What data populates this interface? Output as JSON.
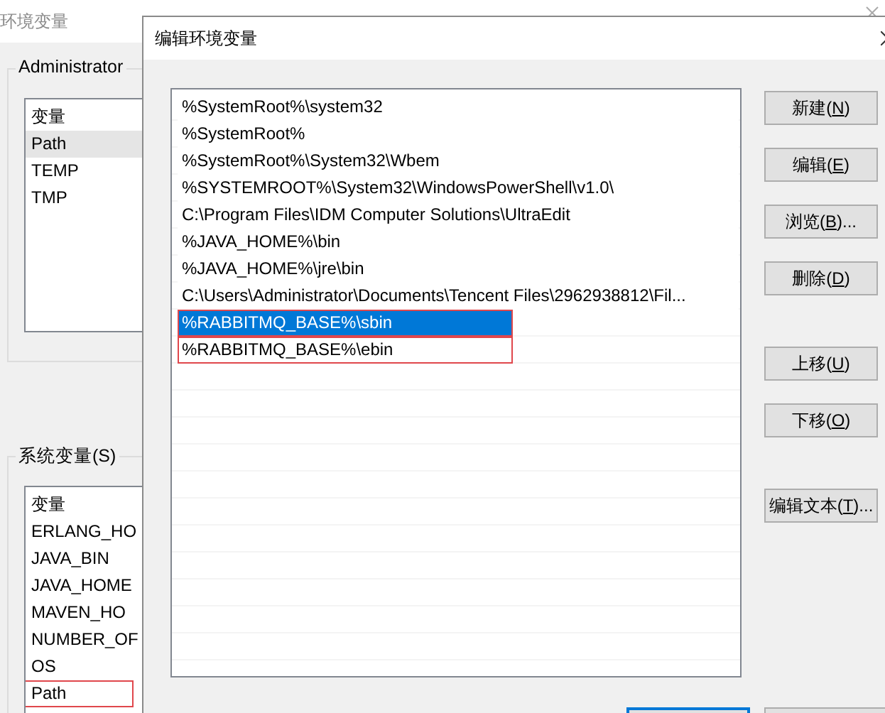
{
  "background_window": {
    "title": "环境变量",
    "user_group": {
      "title": "Administrator",
      "column": "变量",
      "rows": [
        {
          "name": "Path",
          "selected": true,
          "marked": false
        },
        {
          "name": "TEMP",
          "selected": false,
          "marked": false
        },
        {
          "name": "TMP",
          "selected": false,
          "marked": false
        }
      ]
    },
    "system_group": {
      "title": "系统变量(S)",
      "column": "变量",
      "rows": [
        {
          "name": "ERLANG_HO",
          "selected": false,
          "marked": false
        },
        {
          "name": "JAVA_BIN",
          "selected": false,
          "marked": false
        },
        {
          "name": "JAVA_HOME",
          "selected": false,
          "marked": false
        },
        {
          "name": "MAVEN_HO",
          "selected": false,
          "marked": false
        },
        {
          "name": "NUMBER_OF",
          "selected": false,
          "marked": false
        },
        {
          "name": "OS",
          "selected": false,
          "marked": false
        },
        {
          "name": "Path",
          "selected": false,
          "marked": true
        }
      ]
    }
  },
  "dialog": {
    "title": "编辑环境变量",
    "entries": [
      {
        "text": "%SystemRoot%\\system32",
        "selected": false,
        "marked": false
      },
      {
        "text": "%SystemRoot%",
        "selected": false,
        "marked": false
      },
      {
        "text": "%SystemRoot%\\System32\\Wbem",
        "selected": false,
        "marked": false
      },
      {
        "text": "%SYSTEMROOT%\\System32\\WindowsPowerShell\\v1.0\\",
        "selected": false,
        "marked": false
      },
      {
        "text": "C:\\Program Files\\IDM Computer Solutions\\UltraEdit",
        "selected": false,
        "marked": false
      },
      {
        "text": "%JAVA_HOME%\\bin",
        "selected": false,
        "marked": false
      },
      {
        "text": "%JAVA_HOME%\\jre\\bin",
        "selected": false,
        "marked": false
      },
      {
        "text": "C:\\Users\\Administrator\\Documents\\Tencent Files\\2962938812\\Fil...",
        "selected": false,
        "marked": false
      },
      {
        "text": "%RABBITMQ_BASE%\\sbin",
        "selected": true,
        "marked": true
      },
      {
        "text": "%RABBITMQ_BASE%\\ebin",
        "selected": false,
        "marked": true
      }
    ],
    "button_groups": [
      [
        {
          "before": "新建(",
          "key": "N",
          "after": ")"
        },
        {
          "before": "编辑(",
          "key": "E",
          "after": ")"
        },
        {
          "before": "浏览(",
          "key": "B",
          "after": ")..."
        },
        {
          "before": "删除(",
          "key": "D",
          "after": ")"
        }
      ],
      [
        {
          "before": "上移(",
          "key": "U",
          "after": ")"
        },
        {
          "before": "下移(",
          "key": "O",
          "after": ")"
        }
      ],
      [
        {
          "before": "编辑文本(",
          "key": "T",
          "after": ")..."
        }
      ]
    ],
    "footer_buttons": [
      {
        "default": true
      },
      {
        "default": false
      }
    ]
  }
}
